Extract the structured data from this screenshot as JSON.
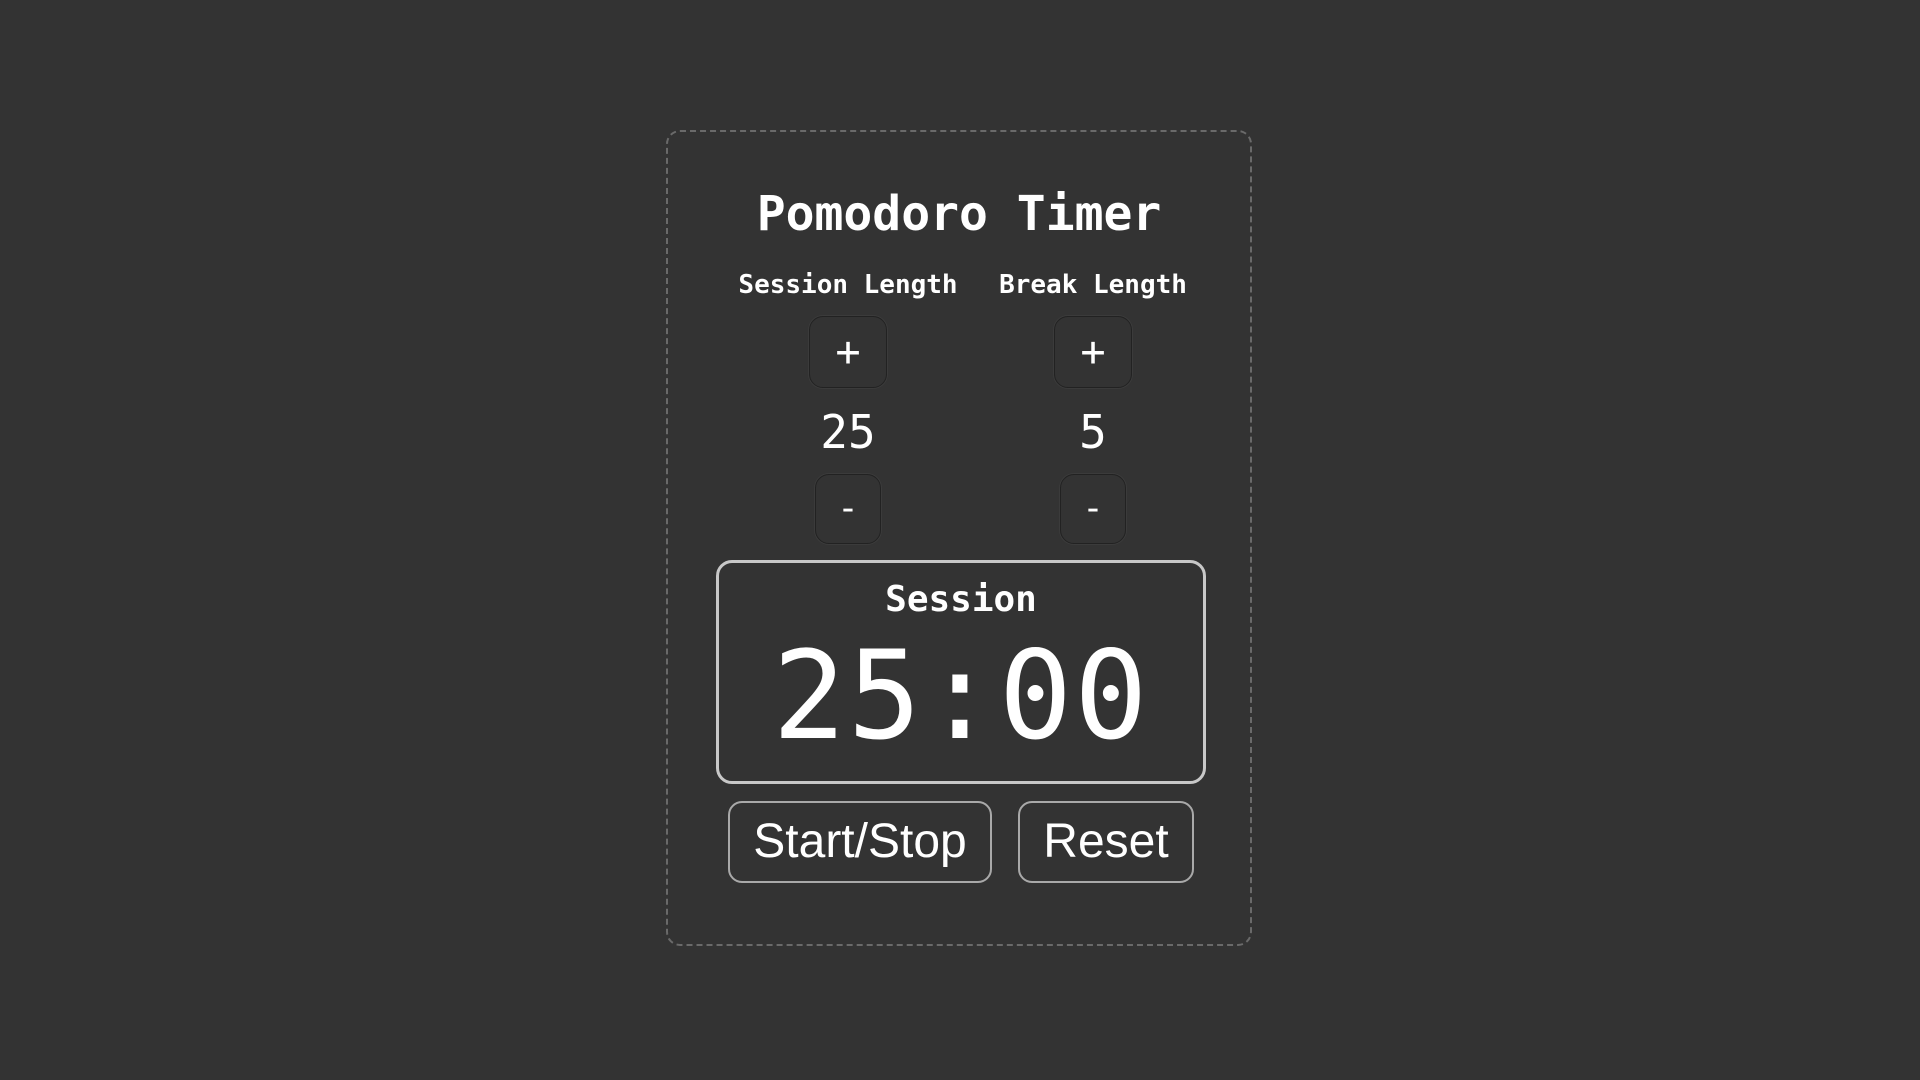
{
  "app": {
    "title": "Pomodoro Timer"
  },
  "session": {
    "label": "Session Length",
    "increment_label": "+",
    "value": "25",
    "decrement_label": "-"
  },
  "break": {
    "label": "Break Length",
    "increment_label": "+",
    "value": "5",
    "decrement_label": "-"
  },
  "timer": {
    "label": "Session",
    "time_left": "25:00"
  },
  "controls": {
    "start_stop_label": "Start/Stop",
    "reset_label": "Reset"
  },
  "colors": {
    "background": "#333333",
    "text": "#ffffff",
    "card_border": "#6a6a6a",
    "timer_border": "#c8c8c8",
    "button_border": "#a9a9a9"
  }
}
